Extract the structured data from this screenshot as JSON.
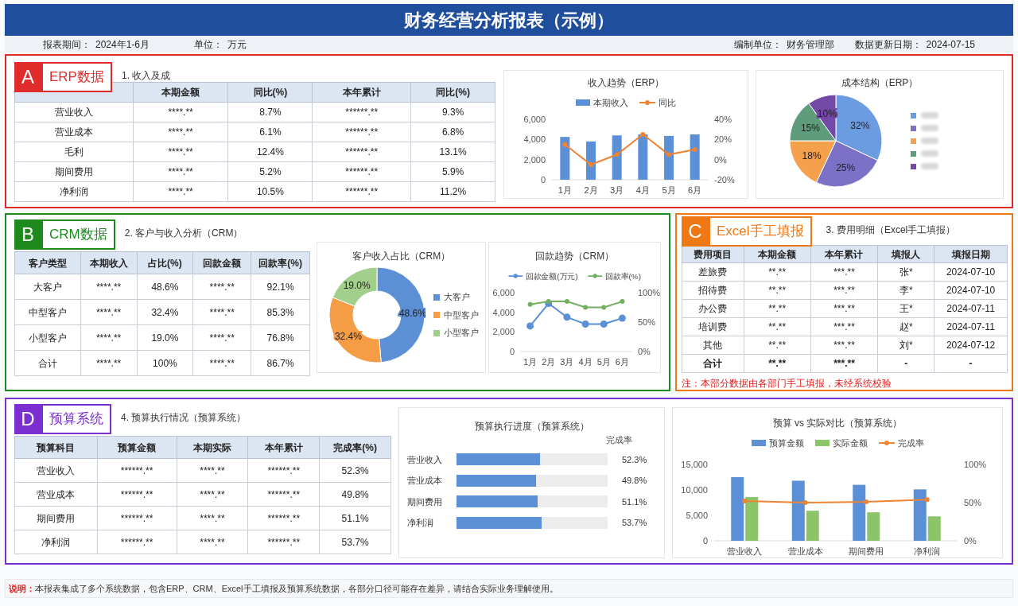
{
  "header": {
    "title": "财务经营分析报表（示例）"
  },
  "info_left": [
    {
      "label": "报表期间：",
      "value": "2024年1-6月"
    },
    {
      "label": "单位：",
      "value": "万元"
    }
  ],
  "info_right": [
    {
      "label": "编制单位：",
      "value": "财务管理部"
    },
    {
      "label": "数据更新日期：",
      "value": "2024-07-15"
    }
  ],
  "erp": {
    "letter": "A",
    "label": "ERP数据",
    "color": "#e02b2b",
    "subtitle": "1. 收入及成",
    "table": {
      "columns": [
        "",
        "本期金额",
        "同比(%)",
        "本年累计",
        "同比(%)"
      ],
      "rows": [
        {
          "cells": [
            "营业收入",
            "****.**",
            "8.7%",
            "******.**",
            "9.3%"
          ]
        },
        {
          "cells": [
            "营业成本",
            "****.**",
            "6.1%",
            "******.**",
            "6.8%"
          ]
        },
        {
          "cells": [
            "毛利",
            "****.**",
            "12.4%",
            "******.**",
            "13.1%"
          ]
        },
        {
          "cells": [
            "期间费用",
            "****.**",
            "5.2%",
            "******.**",
            "5.9%"
          ]
        },
        {
          "cells": [
            "净利润",
            "****.**",
            "10.5%",
            "******.**",
            "11.2%"
          ]
        }
      ]
    },
    "trend_chart": {
      "chart_data": {
        "type": "bar",
        "title": "收入趋势（ERP）",
        "legend": "top",
        "categories": [
          "1月",
          "2月",
          "3月",
          "4月",
          "5月",
          "6月"
        ],
        "series": [
          {
            "name": "本期收入",
            "color": "#5b8fd6",
            "type": "bar",
            "values": [
              4250,
              3800,
              4400,
              4500,
              4350,
              4500
            ]
          },
          {
            "name": "同比",
            "color": "#f08433",
            "type": "line",
            "marker": "circle",
            "axis": "y2",
            "values": [
              15,
              -5,
              5,
              25,
              5,
              10
            ]
          }
        ],
        "ylim": [
          0,
          6000
        ],
        "y2lim": [
          -20,
          40
        ],
        "yticks": [
          {
            "value": 0,
            "label": "0"
          },
          {
            "value": 2000,
            "label": "2,000"
          },
          {
            "value": 4000,
            "label": "4,000"
          },
          {
            "value": 6000,
            "label": "6,000"
          }
        ],
        "y2ticks": [
          {
            "value": -20,
            "label": "-20%"
          },
          {
            "value": 0,
            "label": "0%"
          },
          {
            "value": 20,
            "label": "20%"
          },
          {
            "value": 40,
            "label": "40%"
          }
        ]
      }
    },
    "cost_chart": {
      "chart_data": {
        "type": "pie",
        "title": "成本结构（ERP）",
        "values": [
          32,
          25,
          18,
          15,
          10
        ],
        "colors": [
          "#6b9be0",
          "#7b72c8",
          "#f5a04c",
          "#5f9c7c",
          "#7348a6"
        ],
        "value_labels": [
          "32%",
          "25%",
          "18%",
          "15%",
          "10%"
        ]
      }
    }
  },
  "crm": {
    "letter": "B",
    "label": "CRM数据",
    "color": "#1e8a1e",
    "subtitle": "2. 客户与收入分析（CRM）",
    "table": {
      "columns": [
        "客户类型",
        "本期收入",
        "占比(%)",
        "回款金额",
        "回款率(%)"
      ],
      "rows": [
        {
          "cells": [
            "大客户",
            "****.**",
            "48.6%",
            "****.**",
            "92.1%"
          ]
        },
        {
          "cells": [
            "中型客户",
            "****.**",
            "32.4%",
            "****.**",
            "85.3%"
          ]
        },
        {
          "cells": [
            "小型客户",
            "****.**",
            "19.0%",
            "****.**",
            "76.8%"
          ]
        },
        {
          "cells": [
            "合计",
            "****.**",
            "100%",
            "****.**",
            "86.7%"
          ]
        }
      ]
    },
    "share_chart": {
      "chart_data": {
        "type": "donut",
        "title": "客户收入占比（CRM）",
        "legend": "right",
        "categories": [
          "大客户",
          "中型客户",
          "小型客户"
        ],
        "values": [
          48.6,
          32.4,
          19.0
        ],
        "colors": [
          "#5b8fd6",
          "#f59d45",
          "#a3cf8c"
        ],
        "value_labels": [
          "48.6%",
          "32.4%",
          "19.0%"
        ]
      }
    },
    "payback_chart": {
      "chart_data": {
        "type": "line",
        "title": "回款趋势（CRM）",
        "legend": "top",
        "categories": [
          "1月",
          "2月",
          "3月",
          "4月",
          "5月",
          "6月"
        ],
        "series": [
          {
            "name": "回款金额(万元)",
            "color": "#5b8fd6",
            "marker": "circle",
            "values": [
              2600,
              4900,
              3500,
              2800,
              2800,
              3400
            ]
          },
          {
            "name": "回款率(%)",
            "color": "#72b060",
            "marker": "circle",
            "axis": "y2",
            "values": [
              80,
              85,
              85,
              75,
              75,
              85
            ]
          }
        ],
        "ylim": [
          0,
          6000
        ],
        "y2lim": [
          0,
          100
        ],
        "yticks": [
          {
            "value": 0,
            "label": "0"
          },
          {
            "value": 2000,
            "label": "2,000"
          },
          {
            "value": 4000,
            "label": "4,000"
          },
          {
            "value": 6000,
            "label": "6,000"
          }
        ],
        "y2ticks": [
          {
            "value": 0,
            "label": "0%"
          },
          {
            "value": 50,
            "label": "50%"
          },
          {
            "value": 100,
            "label": "100%"
          }
        ]
      }
    }
  },
  "excel": {
    "letter": "C",
    "label": "Excel手工填报",
    "color": "#f07814",
    "subtitle": "3. 费用明细（Excel手工填报）",
    "table": {
      "columns": [
        "费用项目",
        "本期金额",
        "本年累计",
        "填报人",
        "填报日期"
      ],
      "rows": [
        {
          "kind": "item",
          "cells": [
            "差旅费",
            "**.**",
            "***.**",
            "张*",
            "2024-07-10"
          ]
        },
        {
          "kind": "item",
          "cells": [
            "招待费",
            "**.**",
            "***.**",
            "李*",
            "2024-07-10"
          ]
        },
        {
          "kind": "item",
          "cells": [
            "办公费",
            "**.**",
            "***.**",
            "王*",
            "2024-07-11"
          ]
        },
        {
          "kind": "item",
          "cells": [
            "培训费",
            "**.**",
            "***.**",
            "赵*",
            "2024-07-11"
          ]
        },
        {
          "kind": "item",
          "cells": [
            "其他",
            "**.**",
            "***.**",
            "刘*",
            "2024-07-12"
          ]
        },
        {
          "kind": "total",
          "cells": [
            "合计",
            "**.**",
            "***.**",
            "-",
            "-"
          ]
        }
      ]
    },
    "note": "注：本部分数据由各部门手工填报，未经系统校验"
  },
  "budget": {
    "letter": "D",
    "label": "预算系统",
    "color": "#7b2fd0",
    "subtitle": "4. 预算执行情况（预算系统）",
    "table": {
      "columns": [
        "预算科目",
        "预算金额",
        "本期实际",
        "本年累计",
        "完成率(%)"
      ],
      "rows": [
        {
          "cells": [
            "营业收入",
            "******.**",
            "****.**",
            "******.**",
            "52.3%"
          ]
        },
        {
          "cells": [
            "营业成本",
            "******.**",
            "****.**",
            "******.**",
            "49.8%"
          ]
        },
        {
          "cells": [
            "期间费用",
            "******.**",
            "****.**",
            "******.**",
            "51.1%"
          ]
        },
        {
          "cells": [
            "净利润",
            "******.**",
            "****.**",
            "******.**",
            "53.7%"
          ]
        }
      ]
    },
    "progress_chart": {
      "value_heading": "完成率",
      "chart_data": {
        "type": "bar",
        "orientation": "horizontal",
        "title": "预算执行进度（预算系统）",
        "categories": [
          "营业收入",
          "营业成本",
          "期间费用",
          "净利润"
        ],
        "values": [
          52.3,
          49.8,
          51.1,
          53.7
        ],
        "xlim": [
          0,
          95
        ],
        "value_labels": [
          "52.3%",
          "49.8%",
          "51.1%",
          "53.7%"
        ]
      }
    },
    "compare_chart": {
      "chart_data": {
        "type": "bar",
        "title": "预算 vs 实际对比（预算系统）",
        "legend": "top",
        "categories": [
          "营业收入",
          "营业成本",
          "期间费用",
          "净利润"
        ],
        "series": [
          {
            "name": "预算金额",
            "color": "#5b8fd6",
            "type": "bar",
            "values": [
              12500,
              11800,
              11000,
              10100
            ]
          },
          {
            "name": "实际金额",
            "color": "#8cc46a",
            "type": "bar",
            "values": [
              8600,
              5900,
              5600,
              4800
            ]
          },
          {
            "name": "完成率",
            "color": "#f08433",
            "type": "line",
            "marker": "circle",
            "axis": "y2",
            "values": [
              52,
              50,
              51,
              54
            ]
          }
        ],
        "ylim": [
          0,
          15000
        ],
        "y2lim": [
          0,
          100
        ],
        "yticks": [
          {
            "value": 0,
            "label": "0"
          },
          {
            "value": 5000,
            "label": "5,000"
          },
          {
            "value": 10000,
            "label": "10,000"
          },
          {
            "value": 15000,
            "label": "15,000"
          }
        ],
        "y2ticks": [
          {
            "value": 0,
            "label": "0%"
          },
          {
            "value": 50,
            "label": "50%"
          },
          {
            "value": 100,
            "label": "100%"
          }
        ]
      }
    }
  },
  "footer": {
    "label": "说明：",
    "text": "本报表集成了多个系统数据，包含ERP、CRM、Excel手工填报及预算系统数据，各部分口径可能存在差异，请结合实际业务理解使用。"
  }
}
